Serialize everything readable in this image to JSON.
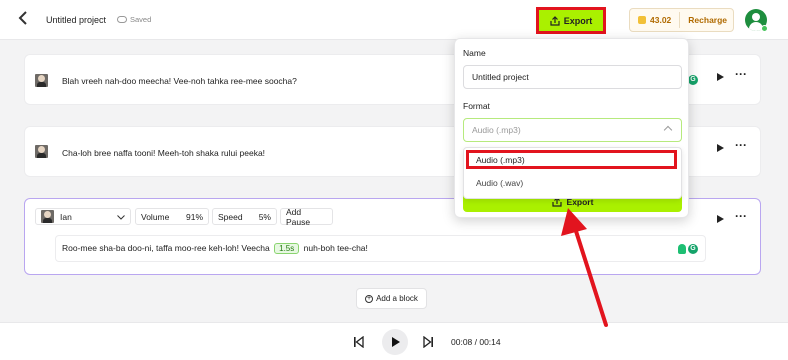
{
  "header": {
    "project_title": "Untitled project",
    "saved_label": "Saved",
    "export_label": "Export",
    "credits": "43.02",
    "recharge_label": "Recharge"
  },
  "blocks": [
    {
      "text": "Blah vreeh nah-doo meecha! Vee-noh tahka ree-mee soocha?"
    },
    {
      "text": "Cha-loh bree naffa tooni! Meeh-toh shaka rului peeka!"
    },
    {
      "voice": "Ian",
      "volume_label": "Volume",
      "volume_value": "91%",
      "speed_label": "Speed",
      "speed_value": "5%",
      "add_pause_label": "Add Pause",
      "text_before": "Roo-mee sha-ba doo-ni, taffa moo-ree keh-loh! Veecha",
      "pause_tag": "1.5s",
      "text_after": "nuh-boh tee-cha!"
    }
  ],
  "add_block_label": "Add a block",
  "player": {
    "time": "00:08 / 00:14"
  },
  "export_panel": {
    "name_label": "Name",
    "name_value": "Untitled project",
    "format_label": "Format",
    "format_selected": "Audio (.mp3)",
    "options": [
      "Audio (.mp3)",
      "Audio (.wav)"
    ],
    "export_label": "Export"
  },
  "colors": {
    "accent_green": "#aaf000",
    "highlight_red": "#e2141e",
    "credit_gold": "#b06a00"
  }
}
